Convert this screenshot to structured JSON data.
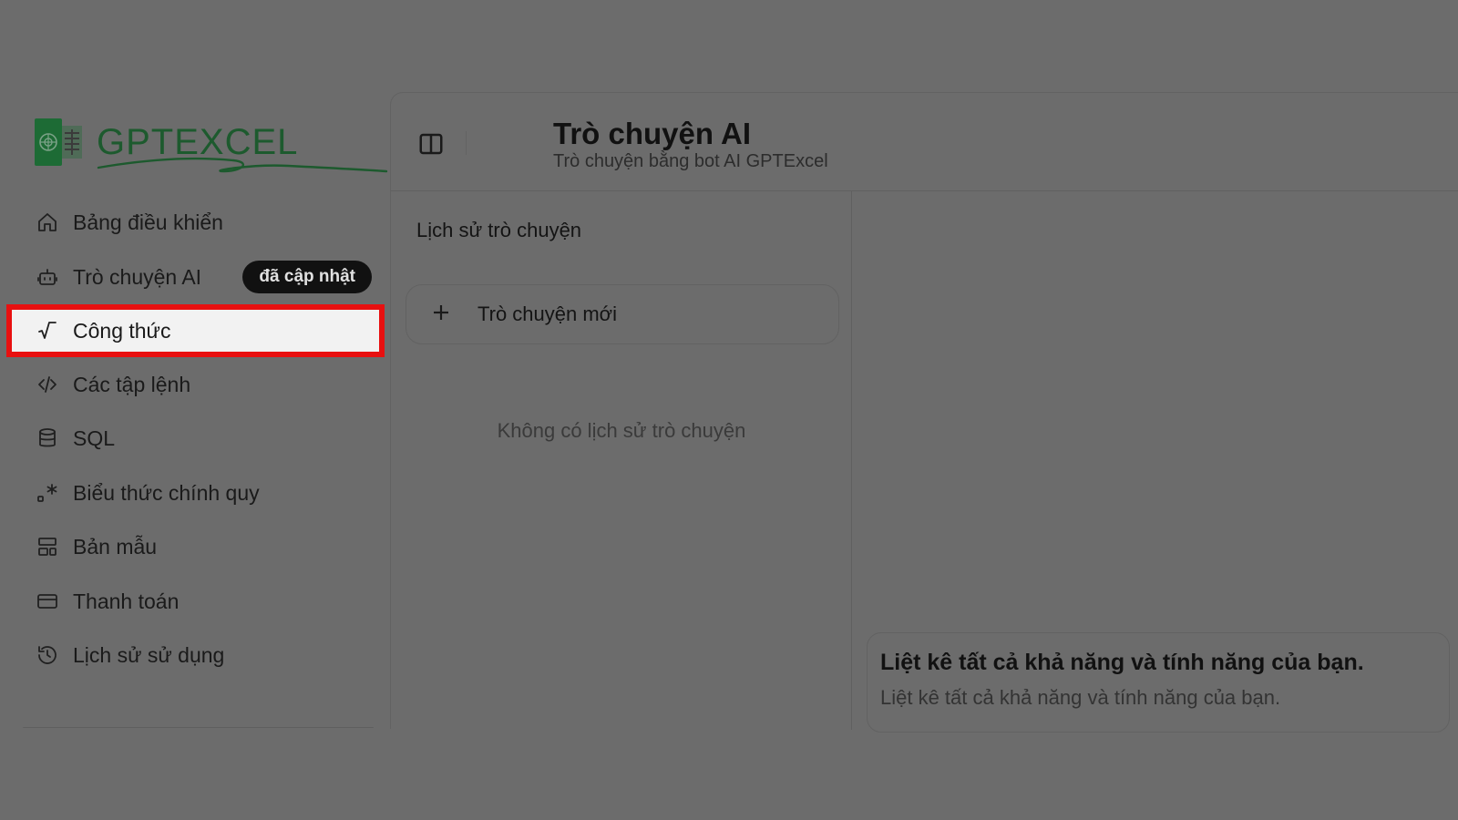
{
  "brand": {
    "name": "GPTEXCEL"
  },
  "colors": {
    "backdrop": "#6c6c6c",
    "highlight_border": "#e81010",
    "brand_green": "#1d5a2e"
  },
  "sidebar": {
    "items": [
      {
        "label": "Bảng điều khiển",
        "icon": "home-icon"
      },
      {
        "label": "Trò chuyện AI",
        "icon": "bot-icon",
        "badge": "đã cập nhật"
      },
      {
        "label": "Công thức",
        "icon": "square-root-icon",
        "highlighted": true
      },
      {
        "label": "Các tập lệnh",
        "icon": "code-icon"
      },
      {
        "label": "SQL",
        "icon": "database-icon"
      },
      {
        "label": "Biểu thức chính quy",
        "icon": "regex-icon"
      },
      {
        "label": "Bản mẫu",
        "icon": "template-icon"
      },
      {
        "label": "Thanh toán",
        "icon": "credit-card-icon"
      },
      {
        "label": "Lịch sử sử dụng",
        "icon": "history-icon"
      }
    ]
  },
  "header": {
    "title": "Trò chuyện AI",
    "subtitle": "Trò chuyện bằng bot AI GPTExcel"
  },
  "history": {
    "title": "Lịch sử trò chuyện",
    "new_chat_label": "Trò chuyện mới",
    "empty_text": "Không có lịch sử trò chuyện"
  },
  "suggestion": {
    "title": "Liệt kê tất cả khả năng và tính năng của bạn.",
    "description": "Liệt kê tất cả khả năng và tính năng của bạn."
  }
}
